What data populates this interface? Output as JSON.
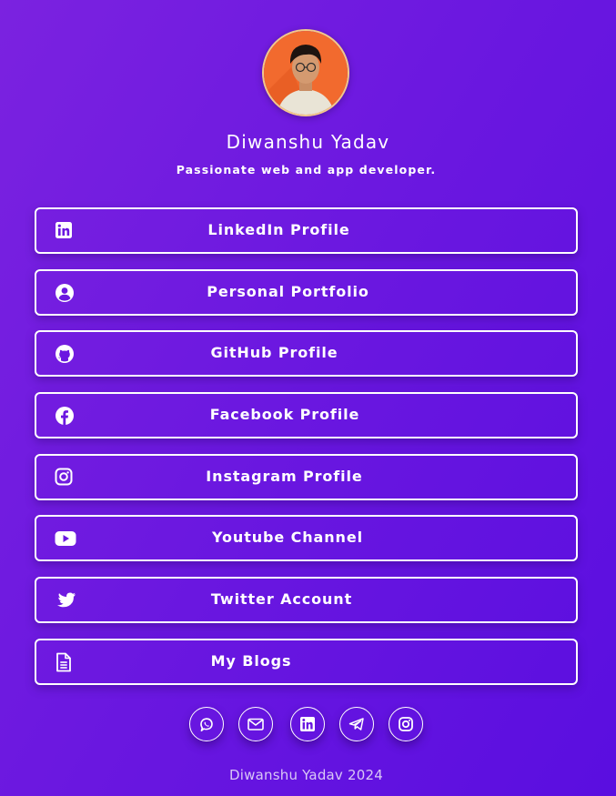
{
  "profile": {
    "name": "Diwanshu Yadav",
    "tagline": "Passionate web and app developer."
  },
  "links": [
    {
      "label": "LinkedIn Profile",
      "icon": "linkedin-icon"
    },
    {
      "label": "Personal Portfolio",
      "icon": "user-circle-icon"
    },
    {
      "label": "GitHub Profile",
      "icon": "github-icon"
    },
    {
      "label": "Facebook Profile",
      "icon": "facebook-icon"
    },
    {
      "label": "Instagram Profile",
      "icon": "instagram-icon"
    },
    {
      "label": "Youtube Channel",
      "icon": "youtube-icon"
    },
    {
      "label": "Twitter Account",
      "icon": "twitter-icon"
    },
    {
      "label": "My Blogs",
      "icon": "document-icon"
    }
  ],
  "socials": [
    {
      "icon": "whatsapp-icon"
    },
    {
      "icon": "email-icon"
    },
    {
      "icon": "linkedin-icon"
    },
    {
      "icon": "telegram-icon"
    },
    {
      "icon": "instagram-icon"
    }
  ],
  "footer": {
    "text": "Diwanshu Yadav 2024"
  },
  "colors": {
    "background_start": "#7b22e0",
    "background_end": "#5a0ee0",
    "foreground": "#ffffff",
    "footer_text": "#d9c8f6",
    "avatar_background": "#f26a2e"
  }
}
